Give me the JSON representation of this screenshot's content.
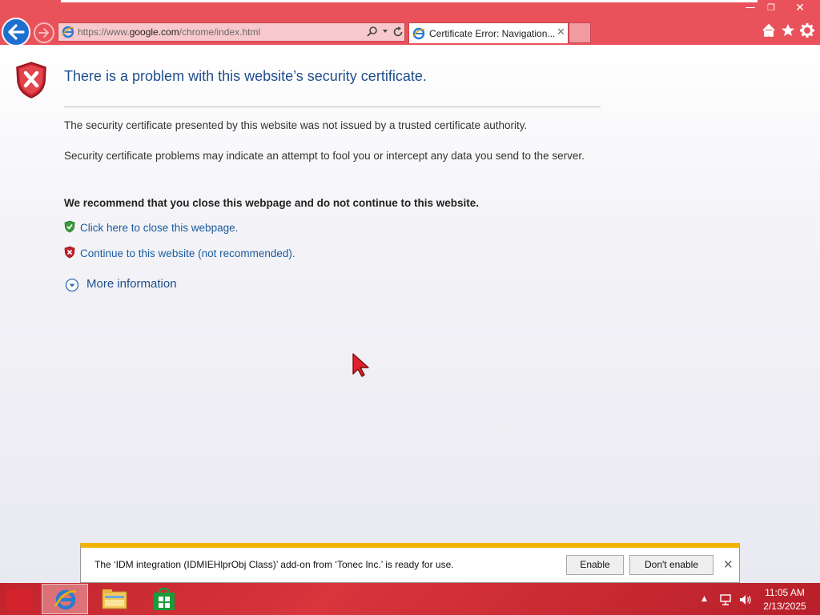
{
  "window": {
    "minimize_glyph": "—",
    "restore_glyph": "❐",
    "close_glyph": "✕"
  },
  "nav": {
    "back_icon": "back-arrow-icon",
    "forward_icon": "forward-arrow-icon"
  },
  "address_bar": {
    "url_prefix": "https://www.",
    "url_domain": "google.com",
    "url_path": "/chrome/index.html"
  },
  "tab": {
    "title": "Certificate Error: Navigation...",
    "close_glyph": "✕"
  },
  "page": {
    "title": "There is a problem with this website’s security certificate.",
    "para1": "The security certificate presented by this website was not issued by a trusted certificate authority.",
    "para2": "Security certificate problems may indicate an attempt to fool you or intercept any data you send to the server.",
    "recommendation": "We recommend that you close this webpage and do not continue to this website.",
    "link_close": "Click here to close this webpage.",
    "link_continue": "Continue to this website (not recommended).",
    "more_info": "More information"
  },
  "notification": {
    "message": "The ‘IDM integration (IDMIEHlprObj Class)’ add-on from ‘Tonec Inc.’ is ready for use.",
    "enable_label": "Enable",
    "dont_enable_label": "Don't enable",
    "close_glyph": "✕"
  },
  "taskbar": {
    "tray_up_glyph": "▲",
    "time": "11:05 AM",
    "date": "2/13/2025"
  },
  "colors": {
    "accent": "#e9525b",
    "link": "#1a5a9e",
    "title": "#1f4e8c",
    "taskbar": "#c92a33",
    "notification_bar": "#f2b300"
  }
}
